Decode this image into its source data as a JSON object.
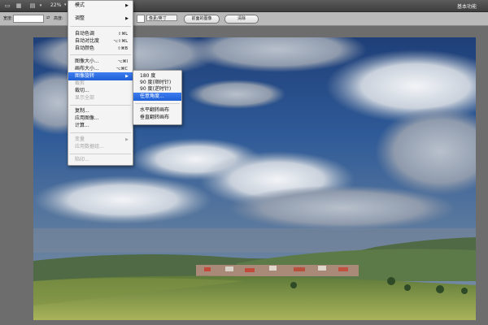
{
  "appbar": {
    "zoom": "22%",
    "workspace": "基本功能",
    "icons": [
      "screen-mode-icon",
      "document-icon",
      "arrange-icon",
      "zoom-dropdown-icon"
    ]
  },
  "optbar": {
    "width_label": "宽度:",
    "height_label": "高度:",
    "resolution_unit": "像素/英寸",
    "front_image_button": "前面的图像",
    "clear_button": "清除"
  },
  "menu_image": {
    "items": [
      {
        "label": "模式",
        "submenu": true
      },
      {
        "label": "调整",
        "submenu": true
      },
      {
        "label": "自动色调",
        "shortcut": "⇧⌘L"
      },
      {
        "label": "自动对比度",
        "shortcut": "⌥⇧⌘L"
      },
      {
        "label": "自动颜色",
        "shortcut": "⇧⌘B"
      },
      {
        "label": "图像大小...",
        "shortcut": "⌥⌘I"
      },
      {
        "label": "画布大小...",
        "shortcut": "⌥⌘C"
      },
      {
        "label": "图像旋转",
        "submenu": true,
        "highlighted": true
      },
      {
        "label": "裁剪",
        "disabled": true
      },
      {
        "label": "裁切..."
      },
      {
        "label": "显示全部",
        "disabled": true
      },
      {
        "label": "复制..."
      },
      {
        "label": "应用图像..."
      },
      {
        "label": "计算..."
      },
      {
        "label": "变量",
        "submenu": true,
        "disabled": true
      },
      {
        "label": "应用数据组...",
        "disabled": true
      },
      {
        "label": "陷印...",
        "disabled": true
      }
    ]
  },
  "menu_rotate": {
    "items": [
      {
        "label": "180 度"
      },
      {
        "label": "90 度(顺时针)"
      },
      {
        "label": "90 度(逆时针)"
      },
      {
        "label": "任意角度...",
        "highlighted": true
      },
      {
        "label": "水平翻转画布"
      },
      {
        "label": "垂直翻转画布"
      }
    ]
  },
  "photo": {
    "description_icon": "landscape-photo"
  }
}
